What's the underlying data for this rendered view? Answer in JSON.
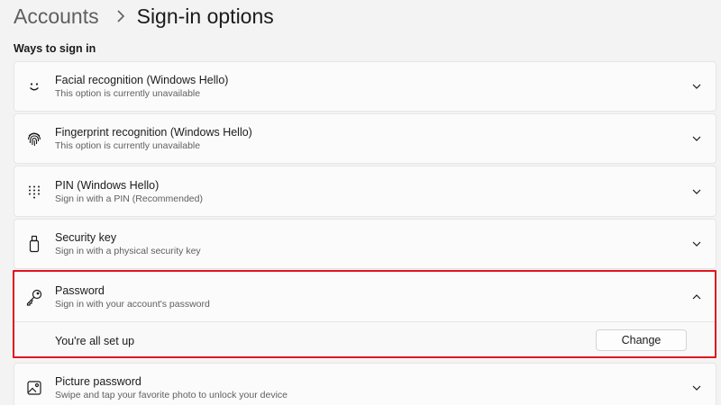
{
  "breadcrumb": {
    "parent": "Accounts",
    "current": "Sign-in options"
  },
  "section": {
    "title": "Ways to sign in"
  },
  "options": [
    {
      "title": "Facial recognition (Windows Hello)",
      "subtitle": "This option is currently unavailable",
      "icon": "smile-icon"
    },
    {
      "title": "Fingerprint recognition (Windows Hello)",
      "subtitle": "This option is currently unavailable",
      "icon": "fingerprint-icon"
    },
    {
      "title": "PIN (Windows Hello)",
      "subtitle": "Sign in with a PIN (Recommended)",
      "icon": "keypad-icon"
    },
    {
      "title": "Security key",
      "subtitle": "Sign in with a physical security key",
      "icon": "usb-key-icon"
    },
    {
      "title": "Password",
      "subtitle": "Sign in with your account's password",
      "icon": "key-icon",
      "expanded": true,
      "status": "You're all set up",
      "action_label": "Change"
    },
    {
      "title": "Picture password",
      "subtitle": "Swipe and tap your favorite photo to unlock your device",
      "icon": "picture-icon"
    }
  ],
  "colors": {
    "highlight": "#e0141e",
    "background": "#f3f3f3",
    "card": "#fbfbfb"
  }
}
